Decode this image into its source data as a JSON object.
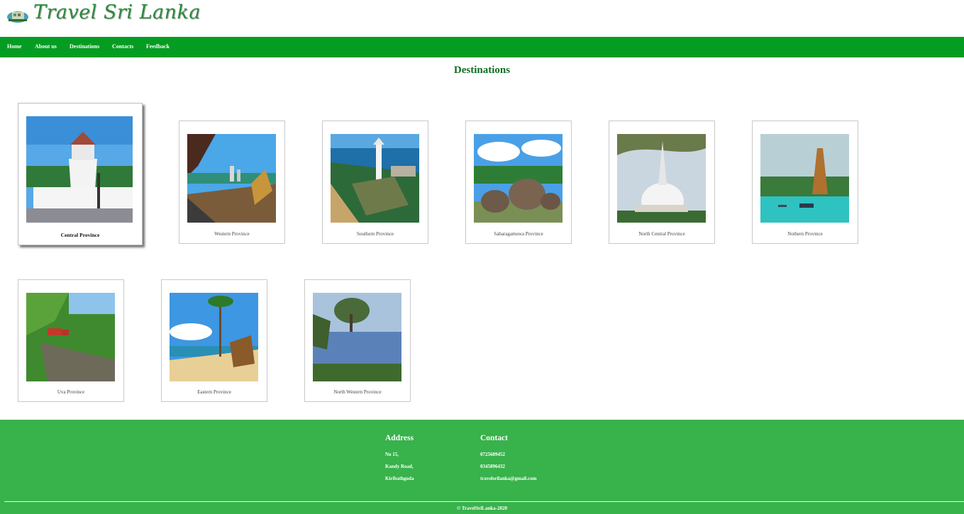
{
  "header": {
    "brand": "Travel Sri Lanka"
  },
  "nav": {
    "items": [
      {
        "label": "Home"
      },
      {
        "label": "About us"
      },
      {
        "label": "Destinations"
      },
      {
        "label": "Contacts"
      },
      {
        "label": "Feedback"
      }
    ]
  },
  "main": {
    "title": "Destinations",
    "destinations": [
      {
        "label": "Central Province"
      },
      {
        "label": "Western Province"
      },
      {
        "label": "Southern Province"
      },
      {
        "label": "Sabaragamuwa Province"
      },
      {
        "label": "North Central Province"
      },
      {
        "label": "Nothern Province"
      },
      {
        "label": "Uva Province"
      },
      {
        "label": "Eastern Province"
      },
      {
        "label": "North Western Province"
      }
    ]
  },
  "footer": {
    "address_title": "Address",
    "address_lines": [
      "No 15,",
      "Kandy Road,",
      "Kiribathgoda"
    ],
    "contact_title": "Contact",
    "contact_lines": [
      "0725689452",
      "0345896432",
      "travelsrilanka@gmail.com"
    ],
    "copyright": "© TravelSriLanka-2020"
  },
  "colors": {
    "nav_bg": "#049d22",
    "footer_bg": "#38b24b",
    "title_green": "#0f6e24"
  }
}
